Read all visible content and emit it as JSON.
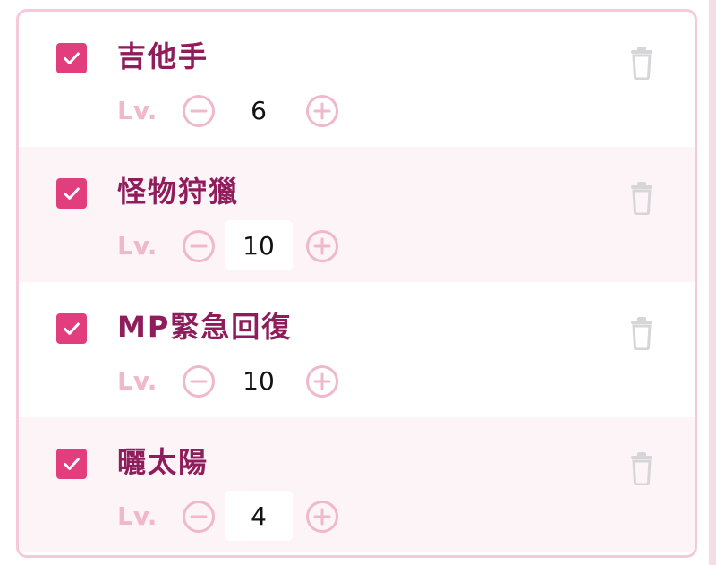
{
  "lv_label": "Lv.",
  "colors": {
    "accent": "#e23e7e",
    "name": "#8f1c5b",
    "muted_pink": "#f0b8cb",
    "trash": "#d6d6d9",
    "border": "#f6c9da"
  },
  "skills": [
    {
      "name": "吉他手",
      "checked": true,
      "level": "6"
    },
    {
      "name": "怪物狩獵",
      "checked": true,
      "level": "10"
    },
    {
      "name": "MP緊急回復",
      "checked": true,
      "level": "10"
    },
    {
      "name": "曬太陽",
      "checked": true,
      "level": "4"
    }
  ],
  "icons": {
    "checkbox": "check-icon",
    "trash": "trash-icon",
    "minus": "minus-circle-icon",
    "plus": "plus-circle-icon"
  }
}
